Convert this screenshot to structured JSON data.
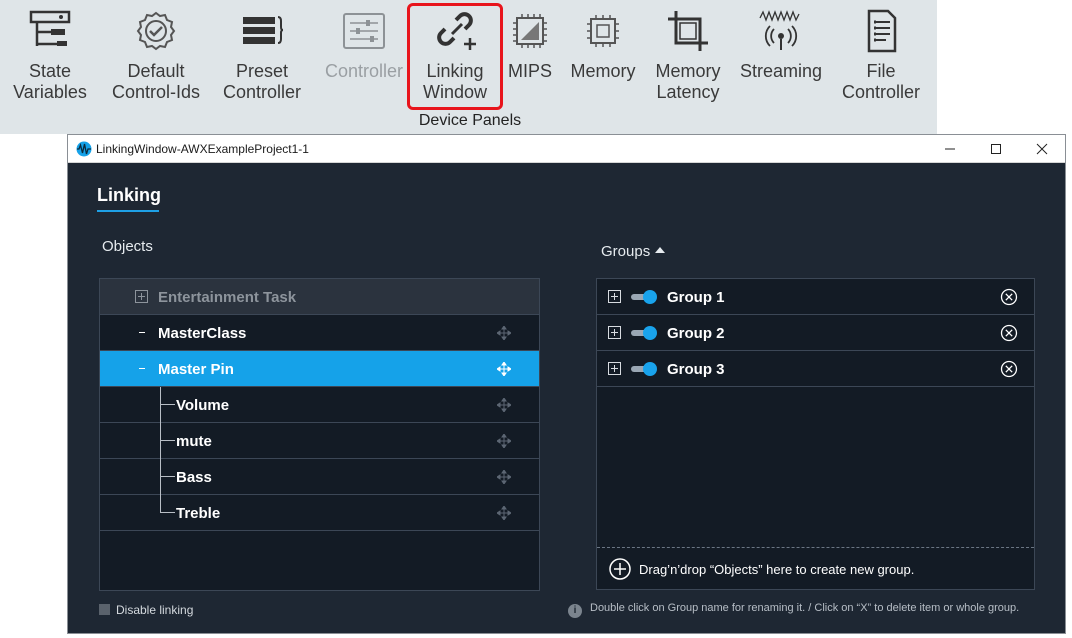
{
  "ribbon": {
    "items": [
      {
        "label_1": "State",
        "label_2": "Variables",
        "icon": "state-variables-icon"
      },
      {
        "label_1": "Default",
        "label_2": "Control-Ids",
        "icon": "gear-check-icon"
      },
      {
        "label_1": "Preset",
        "label_2": "Controller",
        "icon": "preset-stack-icon"
      },
      {
        "label_1": "Controller",
        "label_2": "",
        "icon": "sliders-icon"
      },
      {
        "label_1": "Linking",
        "label_2": "Window",
        "icon": "link-plus-icon"
      },
      {
        "label_1": "MIPS",
        "label_2": "",
        "icon": "chip-icon"
      },
      {
        "label_1": "Memory",
        "label_2": "",
        "icon": "memory-chip-icon"
      },
      {
        "label_1": "Memory",
        "label_2": "Latency",
        "icon": "crop-frame-icon"
      },
      {
        "label_1": "Streaming",
        "label_2": "",
        "icon": "antenna-wave-icon"
      },
      {
        "label_1": "File",
        "label_2": "Controller",
        "icon": "document-icon"
      }
    ],
    "group_label": "Device Panels",
    "highlight_color": "#e8141c"
  },
  "window": {
    "title": "LinkingWindow-AWXExampleProject1-1",
    "tab": "Linking",
    "objects_label": "Objects",
    "groups_label": "Groups",
    "objects": {
      "header": "Entertainment Task",
      "class": "MasterClass",
      "pin": "Master Pin",
      "children": [
        "Volume",
        "mute",
        "Bass",
        "Treble"
      ]
    },
    "groups": [
      "Group 1",
      "Group 2",
      "Group 3"
    ],
    "drop_hint": "Drag’n’drop “Objects” here to create new group.",
    "disable_linking": "Disable linking",
    "footer_hint": "Double click on Group name for renaming it. / Click on “X” to delete item or whole group.",
    "accent_color": "#15a2e9"
  }
}
